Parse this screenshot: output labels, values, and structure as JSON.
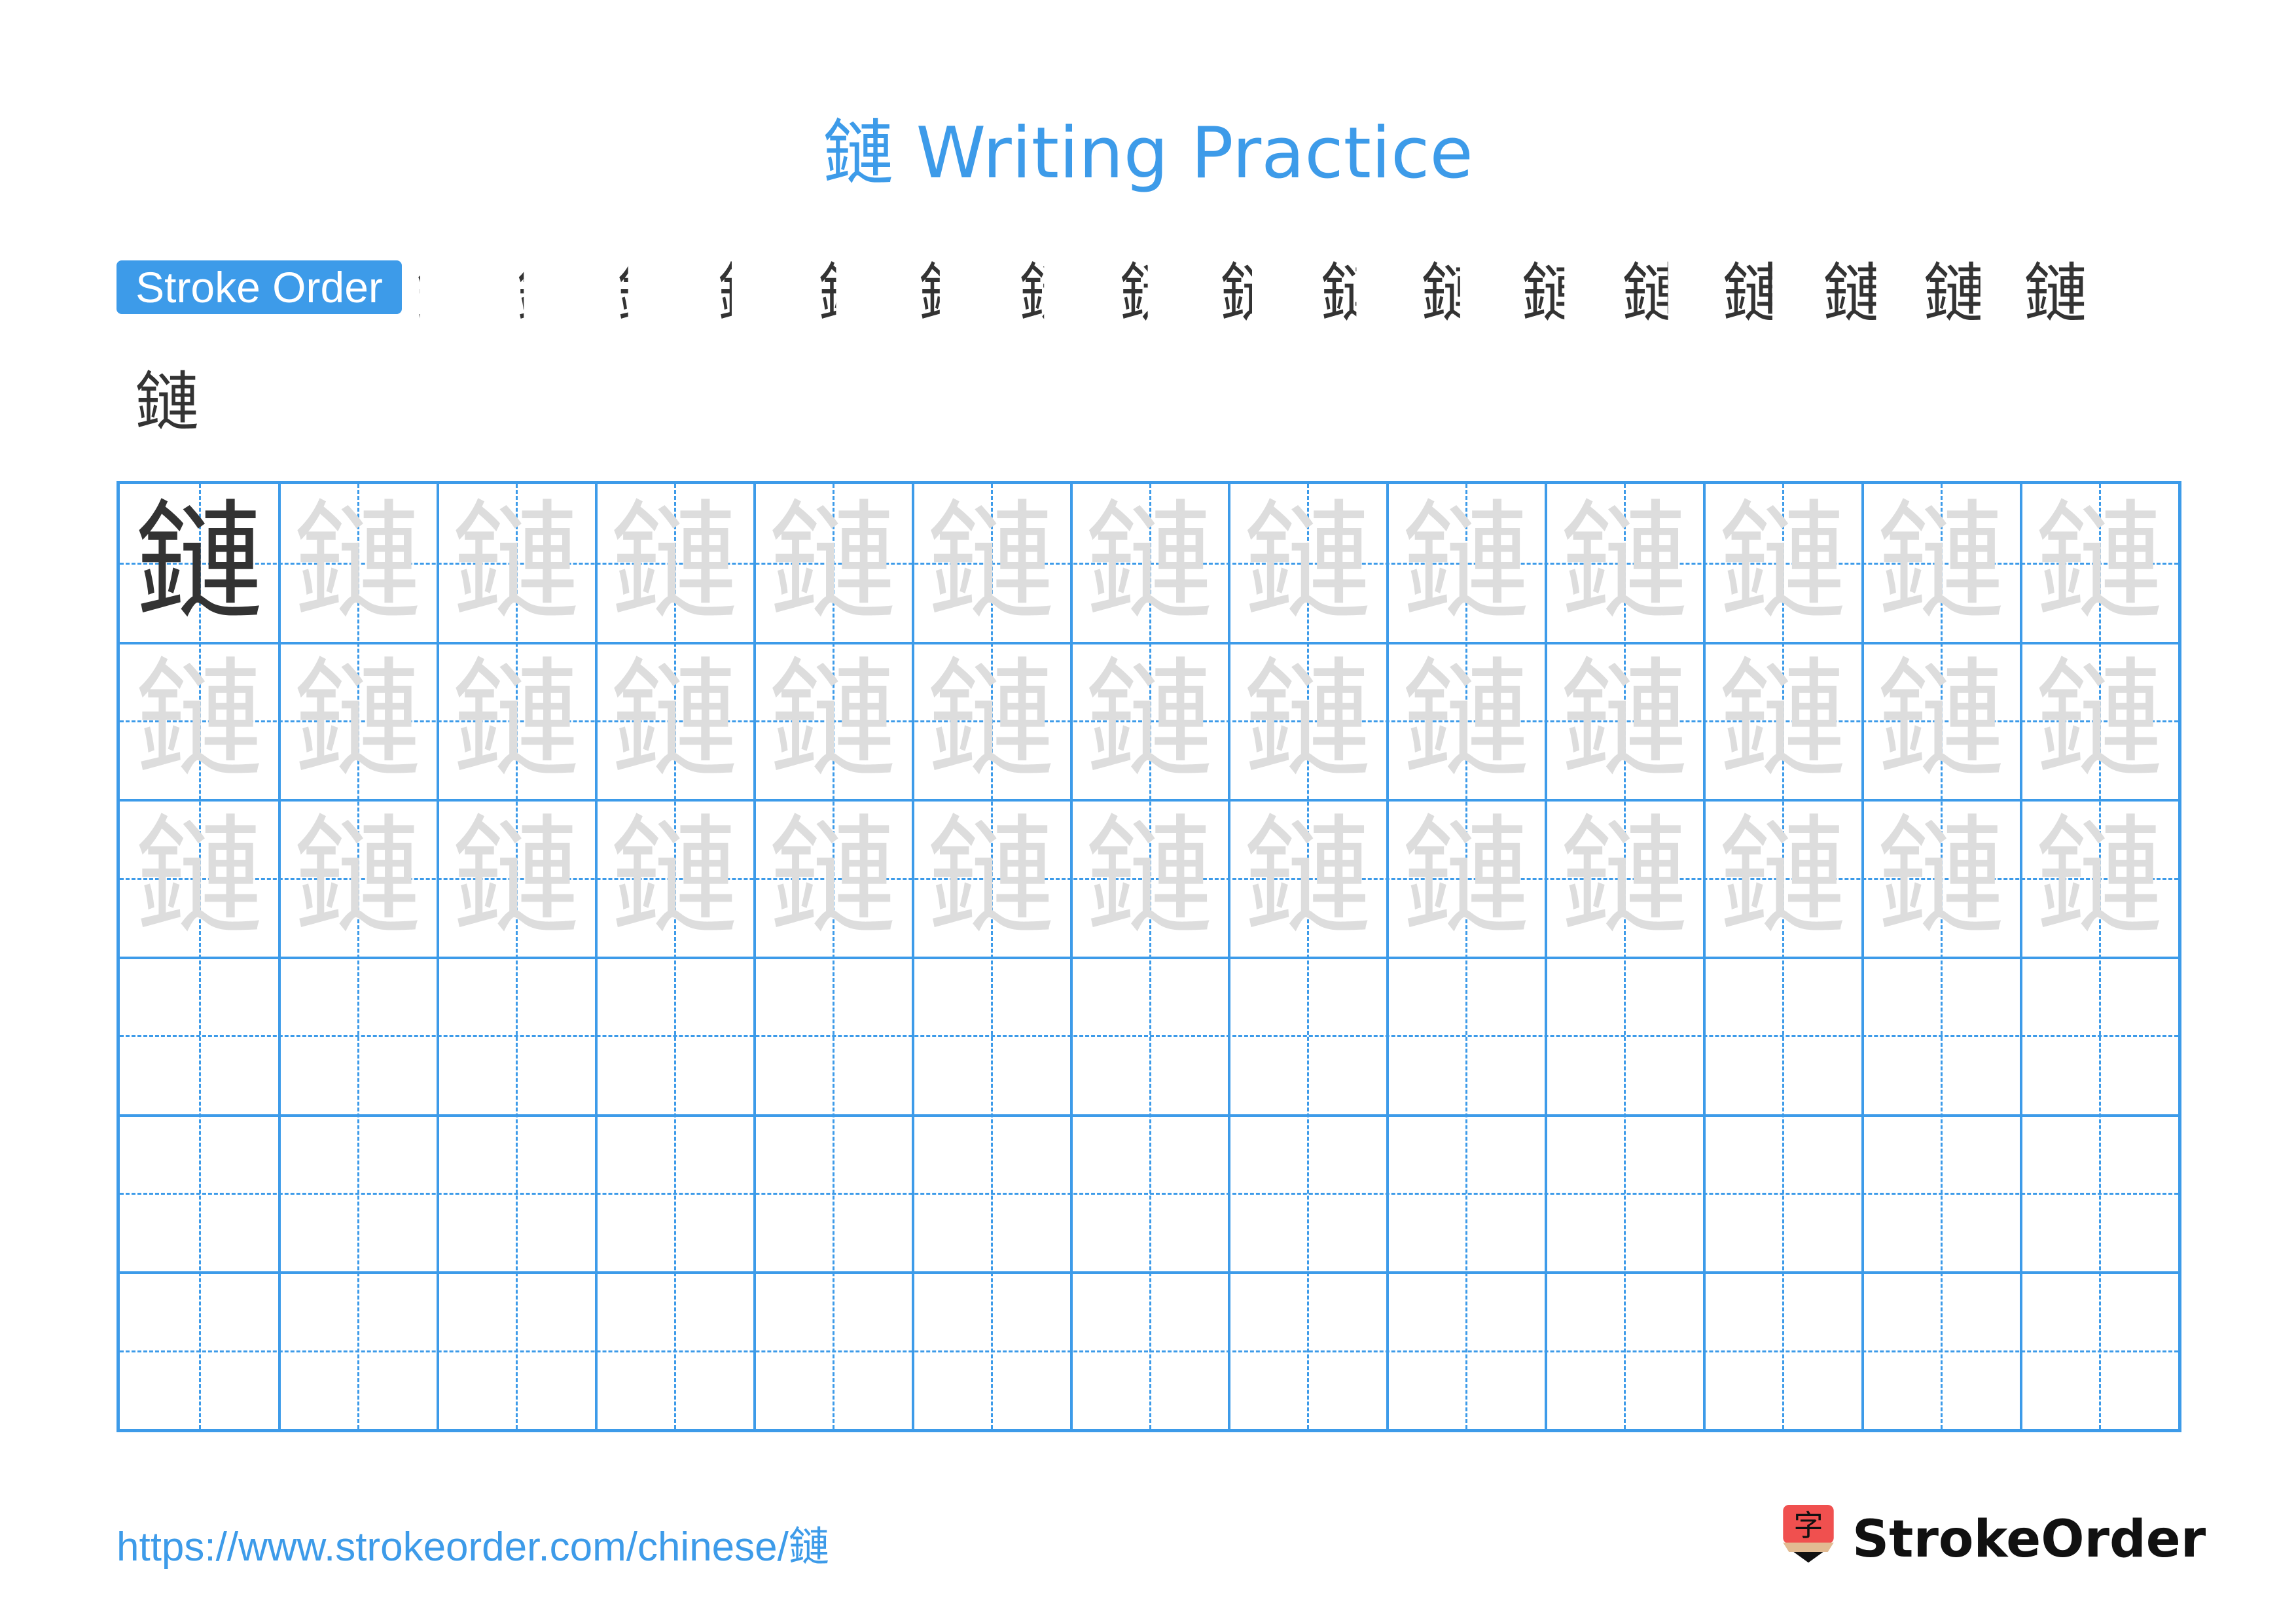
{
  "title": "鏈 Writing Practice",
  "character": "鏈",
  "stroke_order": {
    "badge_label": "Stroke Order",
    "total_strokes": 18,
    "frames_row1": 17,
    "frames_row2": 1
  },
  "grid": {
    "rows": 6,
    "cols": 13,
    "model_cells": 1,
    "trace_rows": 3,
    "empty_rows": 3
  },
  "colors": {
    "accent": "#3d9be9",
    "stroke_highlight": "#ff0000",
    "model_glyph": "#333333",
    "trace_glyph": "#dddddd"
  },
  "footer": {
    "url": "https://www.strokeorder.com/chinese/鏈",
    "logo_icon_char": "字",
    "logo_text": "StrokeOrder"
  }
}
